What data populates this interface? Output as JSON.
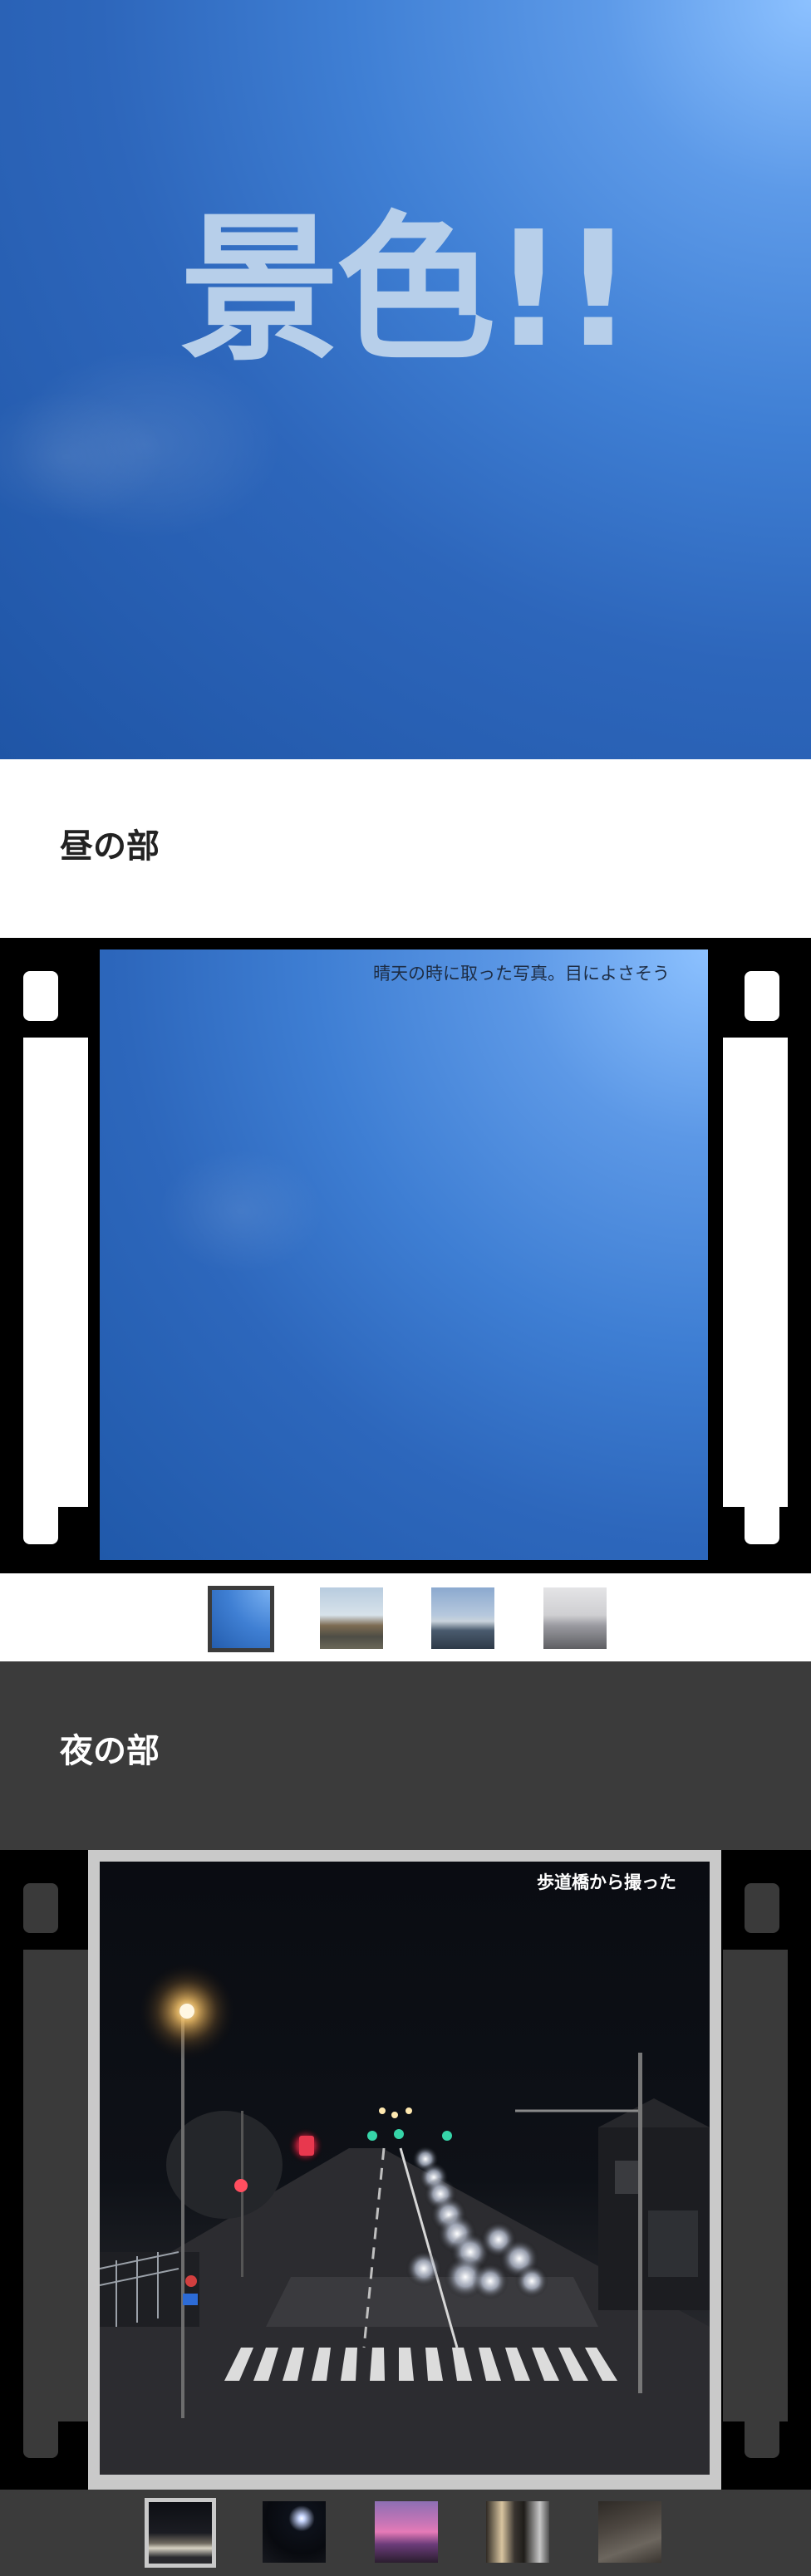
{
  "hero": {
    "title": "景色!!"
  },
  "day": {
    "heading": "昼の部",
    "caption": "晴天の時に取った写真。目によさそう",
    "thumbnails": [
      {
        "name": "sky",
        "active": true
      },
      {
        "name": "river"
      },
      {
        "name": "sea"
      },
      {
        "name": "fog"
      }
    ]
  },
  "night": {
    "heading": "夜の部",
    "caption": "歩道橋から撮った",
    "thumbnails": [
      {
        "name": "street",
        "active": true
      },
      {
        "name": "moon"
      },
      {
        "name": "sunset"
      },
      {
        "name": "alley"
      },
      {
        "name": "tree"
      }
    ]
  },
  "colors": {
    "hero_text": "#b7cfea",
    "night_bg": "#3b3b3b",
    "film": "#000000"
  }
}
